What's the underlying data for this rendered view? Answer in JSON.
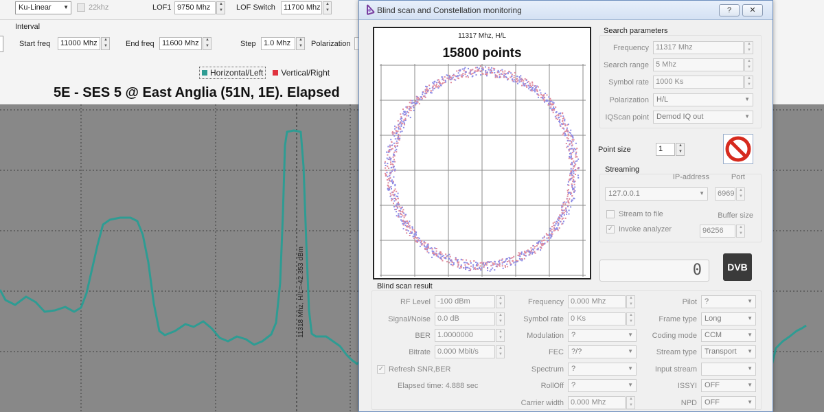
{
  "toolbar": {
    "lnb_type": "Ku-Linear",
    "tone_label": "22khz",
    "lof1_label": "LOF1",
    "lof1_value": "9750 Mhz",
    "lof_switch_label": "LOF Switch",
    "lof_switch_value": "11700 Mhz"
  },
  "interval": {
    "group_label": "Interval",
    "start_label": "Start freq",
    "start_value": "11000 Mhz",
    "end_label": "End freq",
    "end_value": "11600 Mhz",
    "step_label": "Step",
    "step_value": "1.0 Mhz",
    "polarization_label": "Polarization"
  },
  "legend": [
    {
      "label": "Horizontal/Left",
      "color": "#2e9c93"
    },
    {
      "label": "Vertical/Right",
      "color": "#e0333f"
    }
  ],
  "spectrum": {
    "title": "5E - SES 5 @ East Anglia (51N, 1E). Elapsed",
    "marker_label": "11318 Mhz, H/L=-42.353 dBm",
    "trace_color": "#2e9c93",
    "background_color": "#888888",
    "grid": true
  },
  "dialog": {
    "title": "Blind scan and Constellation monitoring",
    "help_button": "?",
    "close_button": "✕",
    "constellation": {
      "frequency_label": "11317 Mhz, H/L",
      "points_label": "15800 points",
      "colors": [
        "#e08a9c",
        "#8a8ae6"
      ]
    },
    "search": {
      "title": "Search parameters",
      "frequency_label": "Frequency",
      "frequency_value": "11317 Mhz",
      "range_label": "Search range",
      "range_value": "5 Mhz",
      "symbol_label": "Symbol rate",
      "symbol_value": "1000 Ks",
      "pol_label": "Polarization",
      "pol_value": "H/L",
      "iq_label": "IQScan point",
      "iq_value": "Demod IQ out"
    },
    "point_size_label": "Point size",
    "point_size_value": "1",
    "streaming": {
      "title": "Streaming",
      "ip_label": "IP-address",
      "ip_value": "127.0.0.1",
      "port_label": "Port",
      "port_value": "6969",
      "stream_to_file": "Stream to file",
      "buffer_label": "Buffer size",
      "invoke_analyzer": "Invoke analyzer",
      "buffer_value": "96256"
    },
    "counter_value": "0",
    "dvb_logo": "DVB",
    "result": {
      "title": "Blind scan result",
      "rf_label": "RF Level",
      "rf_value": "-100 dBm",
      "sn_label": "Signal/Noise",
      "sn_value": "0.0 dB",
      "ber_label": "BER",
      "ber_value": "1.0000000",
      "bitrate_label": "Bitrate",
      "bitrate_value": "0.000 Mbit/s",
      "refresh_label": "Refresh SNR,BER",
      "elapsed_label": "Elapsed time: 4.888 sec",
      "freq_label": "Frequency",
      "freq_value": "0.000 Mhz",
      "sr_label": "Symbol rate",
      "sr_value": "0 Ks",
      "mod_label": "Modulation",
      "mod_value": "?",
      "fec_label": "FEC",
      "fec_value": "?/?",
      "spectrum_label": "Spectrum",
      "spectrum_value": "?",
      "rolloff_label": "RollOff",
      "rolloff_value": "?",
      "carrier_label": "Carrier width",
      "carrier_value": "0.000 Mhz",
      "pilot_label": "Pilot",
      "pilot_value": "?",
      "frame_label": "Frame type",
      "frame_value": "Long",
      "coding_label": "Coding mode",
      "coding_value": "CCM",
      "stream_type_label": "Stream type",
      "stream_type_value": "Transport",
      "input_stream_label": "Input stream",
      "input_stream_value": "",
      "issyi_label": "ISSYI",
      "issyi_value": "OFF",
      "npd_label": "NPD",
      "npd_value": "OFF"
    }
  }
}
